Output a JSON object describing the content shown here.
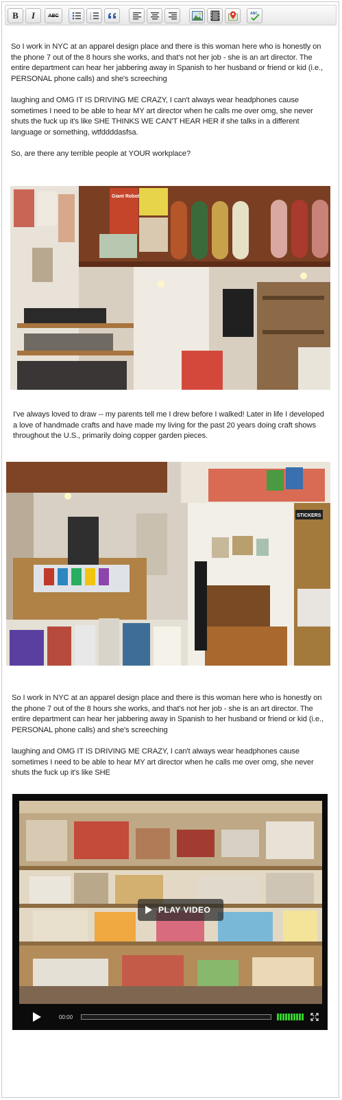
{
  "toolbar": {
    "buttons": [
      {
        "name": "bold-button",
        "label": "B"
      },
      {
        "name": "italic-button",
        "label": "I"
      },
      {
        "name": "spellcheck-button",
        "label": "ABC"
      },
      {
        "name": "bulleted-list-button",
        "label": ""
      },
      {
        "name": "numbered-list-button",
        "label": ""
      },
      {
        "name": "blockquote-button",
        "label": ""
      },
      {
        "name": "align-left-button",
        "label": ""
      },
      {
        "name": "align-center-button",
        "label": ""
      },
      {
        "name": "align-right-button",
        "label": ""
      },
      {
        "name": "insert-image-button",
        "label": ""
      },
      {
        "name": "insert-video-button",
        "label": ""
      },
      {
        "name": "insert-map-button",
        "label": ""
      },
      {
        "name": "spell-check-button",
        "label": ""
      }
    ]
  },
  "content": {
    "p1": "So I work in NYC at an apparel design place and there is this woman here who is honestly on the phone 7 out of the 8 hours she works, and that's not her job - she is an art director. The entire department can hear her jabbering away in Spanish to her husband or friend or kid (i.e., PERSONAL phone calls) and she's screeching",
    "p2": "laughing and OMG IT IS DRIVING ME CRAZY, I can't always wear headphones cause sometimes I need to be able to hear MY art director when he calls me over omg, she never shuts the fuck up it's like SHE THINKS WE CAN'T HEAR HER if she talks in a different language or something, wtfddddasfsa.",
    "p3": "So, are there any terrible people at YOUR workplace?",
    "p4": "I've always loved to draw -- my parents tell me I drew before I walked! Later in life I developed a love of handmade crafts and have made my living for the past 20 years doing craft shows throughout the U.S., primarily doing copper garden pieces.",
    "p5": "So I work in NYC at an apparel design place and there is this woman here who is honestly on the phone 7 out of the 8 hours she works, and that's not her job - she is an art director. The entire department can hear her jabbering away in Spanish to her husband or friend or kid (i.e., PERSONAL phone calls) and she's screeching",
    "p6": "laughing and OMG IT IS DRIVING ME CRAZY, I can't always wear headphones cause sometimes I need to be able to hear MY art director when he calls me over omg, she never shuts the fuck up it's like SHE"
  },
  "photos": {
    "photo1_poster_text": "Giant Robot",
    "photo2_sign_text": "STICKERS"
  },
  "video": {
    "play_label": "PLAY VIDEO",
    "time": "00:00",
    "progress": 0
  }
}
